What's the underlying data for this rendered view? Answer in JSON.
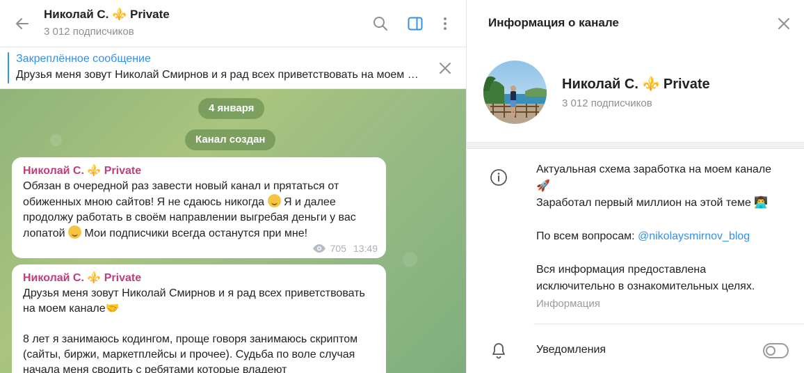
{
  "chat": {
    "title": "Николай С. ⚜️ Private",
    "subscribers": "3 012 подписчиков",
    "pinned": {
      "title": "Закреплённое сообщение",
      "text": "Друзья меня зовут Николай Смирнов и я рад всех приветствовать на моем канале"
    },
    "date_pill": "4 января",
    "service_pill": "Канал создан",
    "messages": [
      {
        "author": "Николай С. ⚜️ Private",
        "text_parts": [
          "Обязан в очередной раз завести новый канал и прятаться от обиженных мною сайтов! Я не сдаюсь никогда ",
          " Я и далее продолжу работать в своём направлении выгребая деньги у вас лопатой ",
          " Мои подписчики всегда останутся при мне!"
        ],
        "views": "705",
        "time": "13:49"
      },
      {
        "author": "Николай С. ⚜️ Private",
        "text": "Друзья меня зовут Николай Смирнов и я рад всех приветствовать на моем канале🤝\n\n8 лет я занимаюсь кодингом, проще говоря занимаюсь скриптом (сайты, биржи, маркетплейсы и прочее). Судьба по воле случая начала меня сводить с ребятами которые владеют"
      }
    ]
  },
  "info": {
    "header_title": "Информация о канале",
    "name": "Николай С. ⚜️ Private",
    "subscribers": "3 012 подписчиков",
    "description": {
      "line1": "Актуальная схема заработка на моем канале 🚀",
      "line2": "Заработал первый миллион на этой теме 👨‍💻",
      "contact_prefix": "По всем вопросам: ",
      "contact_link": "@nikolaysmirnov_blog",
      "line4": "Вся информация предоставлена исключительно в ознакомительных целях."
    },
    "caption": "Информация",
    "notifications_label": "Уведомления",
    "notifications_enabled": false
  },
  "colors": {
    "accent": "#3390ec",
    "author": "#c03d7b"
  },
  "icons": [
    "back-arrow-icon",
    "search-icon",
    "sidebar-toggle-icon",
    "more-vertical-icon",
    "close-icon",
    "info-icon",
    "bell-icon",
    "eye-icon"
  ]
}
